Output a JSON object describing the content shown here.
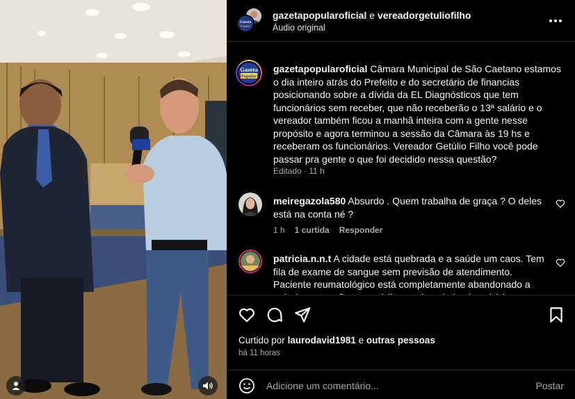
{
  "header": {
    "account1": "gazetapopularoficial",
    "conjunction": "e",
    "account2": "vereadorgetuliofilho",
    "audio": "Áudio original"
  },
  "avatar_text": {
    "line1": "Gazeta",
    "line2": "Popular"
  },
  "caption": {
    "username": "gazetapopularoficial",
    "text": "Câmara Municipal de São Caetano estamos o dia inteiro atrás do Prefeito e do secretário de financias posicionando sobre a dívida da EL Diagnósticos que tem funcionários sem receber, que não receberão o 13ª salário e o vereador também ficou a manhã inteira com a gente nesse propósito e agora terminou a sessão da Câmara às 19 hs e receberam os funcionários. Vereador Getúlio Filho você pode passar pra gente o que foi decidido nessa questão?",
    "meta": "Editado · 11 h"
  },
  "comments": [
    {
      "username": "meiregazola580",
      "text": "Absurdo . Quem trabalha de graça ? O deles está na conta né ?",
      "time": "1 h",
      "likes": "1 curtida",
      "reply": "Responder"
    },
    {
      "username": "patricia.n.n.t",
      "text": "A cidade está quebrada e a saúde um caos. Tem fila de exame de sangue sem previsão de atendimento. Paciente reumatológico está completamente abandonado a própria sorte, não tem médico e o hospital universitário"
    }
  ],
  "likes": {
    "prefix": "Curtido por",
    "user": "laurodavid1981",
    "conj": "e",
    "others": "outras pessoas"
  },
  "time_ago": "há 11 horas",
  "add_comment": {
    "placeholder": "Adicione um comentário...",
    "post_label": "Postar"
  },
  "icons": {
    "like": "heart-icon",
    "comment": "comment-icon",
    "share": "share-icon",
    "save": "bookmark-icon",
    "emoji": "emoji-icon",
    "more": "more-icon",
    "user_tag": "user-icon",
    "audio": "speaker-icon"
  },
  "colors": {
    "background": "#000000",
    "text": "#f5f5f5",
    "muted": "#a8a8a8",
    "divider": "#262626",
    "brand_blue": "#1f3f9a"
  }
}
